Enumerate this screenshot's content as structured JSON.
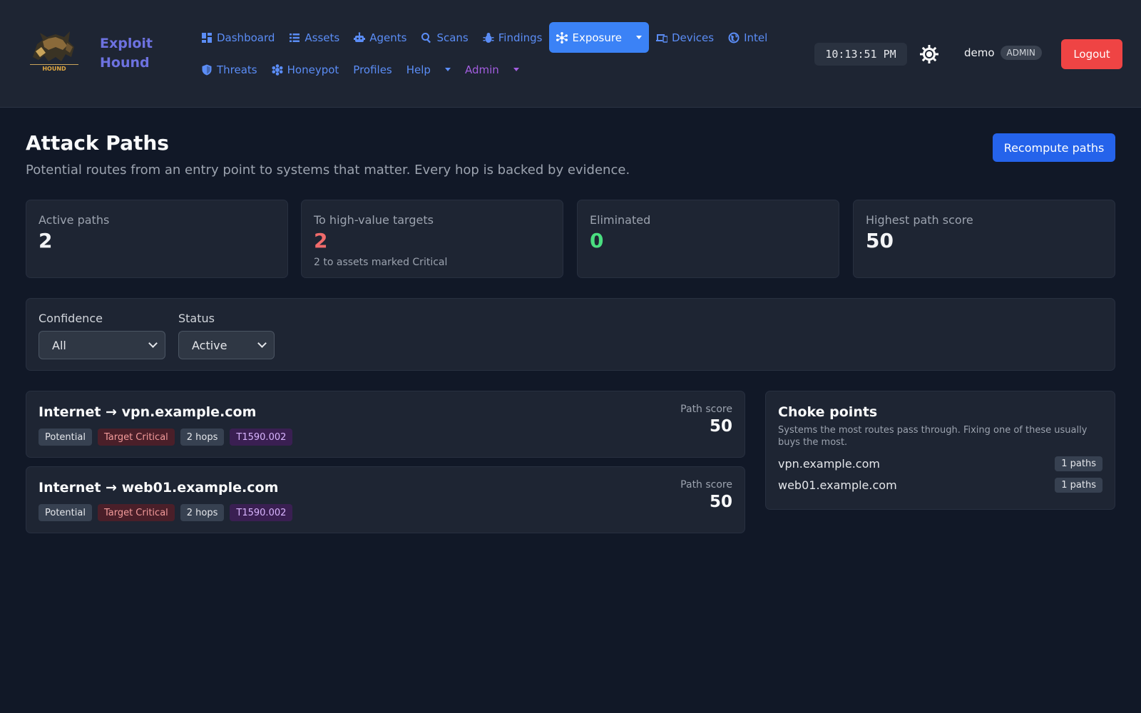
{
  "app": {
    "brand_line1": "Exploit",
    "brand_line2": "Hound",
    "logo_text": "HOUND"
  },
  "nav": {
    "row1": [
      {
        "label": "Dashboard",
        "icon": "dashboard-icon"
      },
      {
        "label": "Assets",
        "icon": "list-icon"
      },
      {
        "label": "Agents",
        "icon": "robot-icon"
      },
      {
        "label": "Scans",
        "icon": "search-icon"
      },
      {
        "label": "Findings",
        "icon": "bug-icon"
      },
      {
        "label": "Exposure",
        "icon": "hub-icon",
        "active": true
      },
      {
        "label": "Devices",
        "icon": "devices-icon"
      },
      {
        "label": "Intel",
        "icon": "globe-icon"
      }
    ],
    "row2": [
      {
        "label": "Threats",
        "icon": "shield-icon"
      },
      {
        "label": "Honeypot",
        "icon": "honeypot-icon"
      },
      {
        "label": "Profiles"
      },
      {
        "label": "Help"
      },
      {
        "label": "Admin"
      }
    ]
  },
  "header": {
    "clock": "10:13:51 PM",
    "theme_icon": "sun-icon",
    "username": "demo",
    "role": "ADMIN",
    "logout_label": "Logout"
  },
  "page": {
    "title": "Attack Paths",
    "subtitle": "Potential routes from an entry point to systems that matter. Every hop is backed by evidence.",
    "recompute_label": "Recompute paths"
  },
  "stats": [
    {
      "label": "Active paths",
      "value": "2",
      "note": ""
    },
    {
      "label": "To high-value targets",
      "value": "2",
      "note": "2 to assets marked Critical"
    },
    {
      "label": "Eliminated",
      "value": "0",
      "note": ""
    },
    {
      "label": "Highest path score",
      "value": "50",
      "note": ""
    }
  ],
  "filters": {
    "confidence": {
      "label": "Confidence",
      "value": "All"
    },
    "status": {
      "label": "Status",
      "value": "Active"
    }
  },
  "paths": [
    {
      "title": "Internet → vpn.example.com",
      "tags": [
        "Potential",
        "Target Critical",
        "2 hops",
        "T1590.002"
      ],
      "score_label": "Path score",
      "score": "50"
    },
    {
      "title": "Internet → web01.example.com",
      "tags": [
        "Potential",
        "Target Critical",
        "2 hops",
        "T1590.002"
      ],
      "score_label": "Path score",
      "score": "50"
    }
  ],
  "choke_points": {
    "title": "Choke points",
    "description": "Systems the most routes pass through. Fixing one of these usually buys the most.",
    "items": [
      {
        "name": "vpn.example.com",
        "count": "1 paths"
      },
      {
        "name": "web01.example.com",
        "count": "1 paths"
      }
    ]
  },
  "colors": {
    "background": "#111827",
    "panel": "#1e2533",
    "accent": "#3b82f6",
    "brand": "#6d72e0",
    "danger": "#ef4444",
    "success": "#4ade80"
  }
}
